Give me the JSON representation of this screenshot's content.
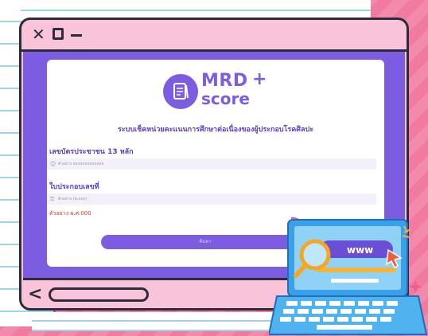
{
  "window": {
    "controls": {
      "close": "close-icon",
      "maximize": "maximize-icon",
      "minimize": "minimize-icon"
    }
  },
  "logo": {
    "line1": "MRD",
    "line2": "score",
    "plus": "+"
  },
  "form": {
    "title": "ระบบเช็คหน่วยคะแนนการศึกษาต่อเนื่องของผู้ประกอบโรคศิลปะ",
    "id_label": "เลขบัตรประชาชน 13 หลัก",
    "id_placeholder": "ตัวอย่าง xxxxxxxxxxxxx",
    "license_label": "ใบประกอบเลขที่",
    "license_placeholder": "ตัวอย่าง (ผ.xxx)",
    "example_text": "ตัวอย่าง ผ.ศ.000",
    "submit_label": "ค้นหา"
  },
  "laptop": {
    "screen_text": "www"
  },
  "colors": {
    "brand": "#7c5ce0",
    "window_pink": "#f9c4d9",
    "background_pink": "#f07aa0",
    "error_red": "#e0352b"
  }
}
